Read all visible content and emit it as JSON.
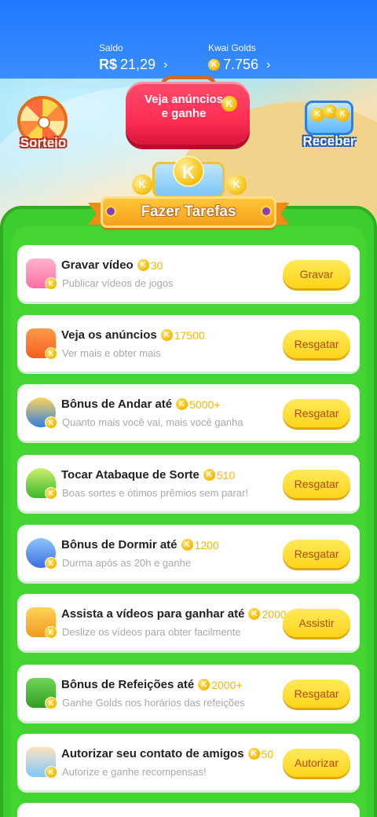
{
  "header": {
    "saldo_label": "Saldo",
    "saldo_currency": "R$",
    "saldo_value": "21,29",
    "golds_label": "Kwai Golds",
    "golds_value": "7.756",
    "chevron": "›"
  },
  "promo": {
    "sorteio_label": "Sorteio",
    "receber_label": "Receber",
    "ad_button_line1": "Veja anúncios",
    "ad_button_line2": "e ganhe",
    "coin_letter": "K"
  },
  "banner": {
    "title": "Fazer Tarefas"
  },
  "tasks": [
    {
      "name": "Gravar vídeo",
      "reward": "30",
      "desc": "Publicar vídeos de jogos",
      "button": "Gravar",
      "icon": "camera-gift-icon"
    },
    {
      "name": "Veja os anúncios",
      "reward": "17500",
      "desc": "Ver mais e obter mais",
      "button": "Resgatar",
      "icon": "tv-play-icon"
    },
    {
      "name": "Bônus de Andar até",
      "reward": "5000+",
      "desc": "Quanto mais você vai, mais você ganha",
      "button": "Resgatar",
      "icon": "walking-person-icon"
    },
    {
      "name": "Tocar Atabaque de Sorte",
      "reward": "510",
      "desc": "Boas sortes e ótimos prêmios sem parar!",
      "button": "Resgatar",
      "icon": "drum-icon"
    },
    {
      "name": "Bônus de Dormir até",
      "reward": "1200",
      "desc": "Durma após as 20h e ganhe",
      "button": "Resgatar",
      "icon": "moon-sleep-icon"
    },
    {
      "name": "Assista a vídeos para ganhar até",
      "reward": "2000",
      "desc": "Deslize os vídeos para obter facilmente",
      "button": "Assistir",
      "icon": "video-camera-icon"
    },
    {
      "name": "Bônus de Refeições até",
      "reward": "2000+",
      "desc": "Ganhe Golds nos horários das refeições",
      "button": "Resgatar",
      "icon": "meal-calendar-icon"
    },
    {
      "name": "Autorizar seu contato de amigos",
      "reward": "50",
      "desc": "Autorize e ganhe recompensas!",
      "button": "Autorizar",
      "icon": "hand-contact-icon"
    }
  ],
  "colors": {
    "header_blue": "#1f78ff",
    "panel_green": "#3ccd2e",
    "button_yellow": "#ffd51a",
    "button_text": "#b04a05",
    "coin_gold": "#f5b800"
  }
}
